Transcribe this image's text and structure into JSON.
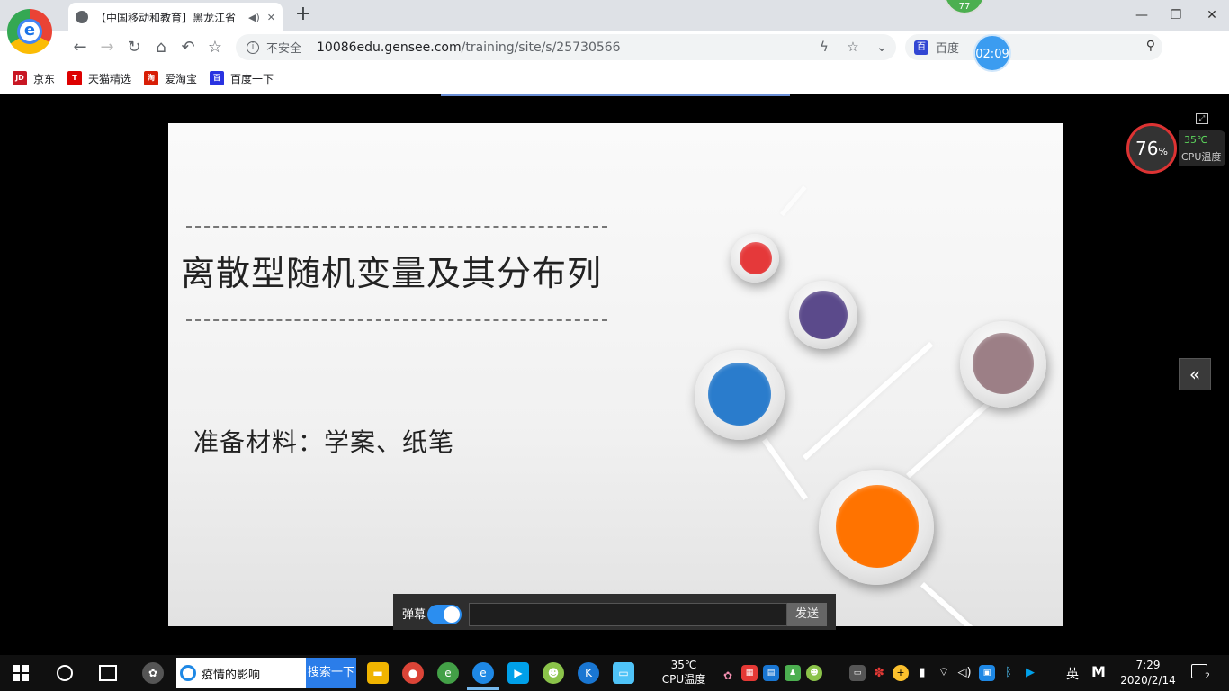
{
  "browser": {
    "tab_title": "【中国移动和教育】黑龙江省",
    "new_tab_label": "+",
    "top_badge": "77",
    "address": {
      "security_label": "不安全",
      "url_host": "10086edu.gensee.com",
      "url_path": "/training/site/s/25730566"
    },
    "search_engine": "百度",
    "timer": "02:09",
    "bookmarks": [
      {
        "label": "京东",
        "icon_text": "JD",
        "color": "#c81623"
      },
      {
        "label": "天猫精选",
        "icon_text": "T",
        "color": "#d00"
      },
      {
        "label": "爱淘宝",
        "icon_text": "淘",
        "color": "#d81e06"
      },
      {
        "label": "百度一下",
        "icon_text": "百",
        "color": "#2932e1"
      }
    ]
  },
  "slide": {
    "title": "离散型随机变量及其分布列",
    "materials": "准备材料：学案、纸笔",
    "dot_colors": {
      "red": "#e5393a",
      "purple": "#5b4a8b",
      "blue": "#2a7ccc",
      "mauve": "#9c7f86",
      "orange": "#ff7300"
    }
  },
  "danmaku": {
    "label": "弹幕",
    "input_value": "",
    "send_label": "发送"
  },
  "cpu_widget": {
    "usage": "76",
    "usage_unit": "%",
    "temperature": "35℃",
    "label": "CPU温度"
  },
  "taskbar": {
    "search_text": "疫情的影响",
    "search_button": "搜索一下",
    "temp_value": "35℃",
    "temp_label": "CPU温度",
    "ime_label": "英",
    "ime_mode": "M",
    "time": "7:29",
    "date": "2020/2/14",
    "notification_count": "2"
  }
}
